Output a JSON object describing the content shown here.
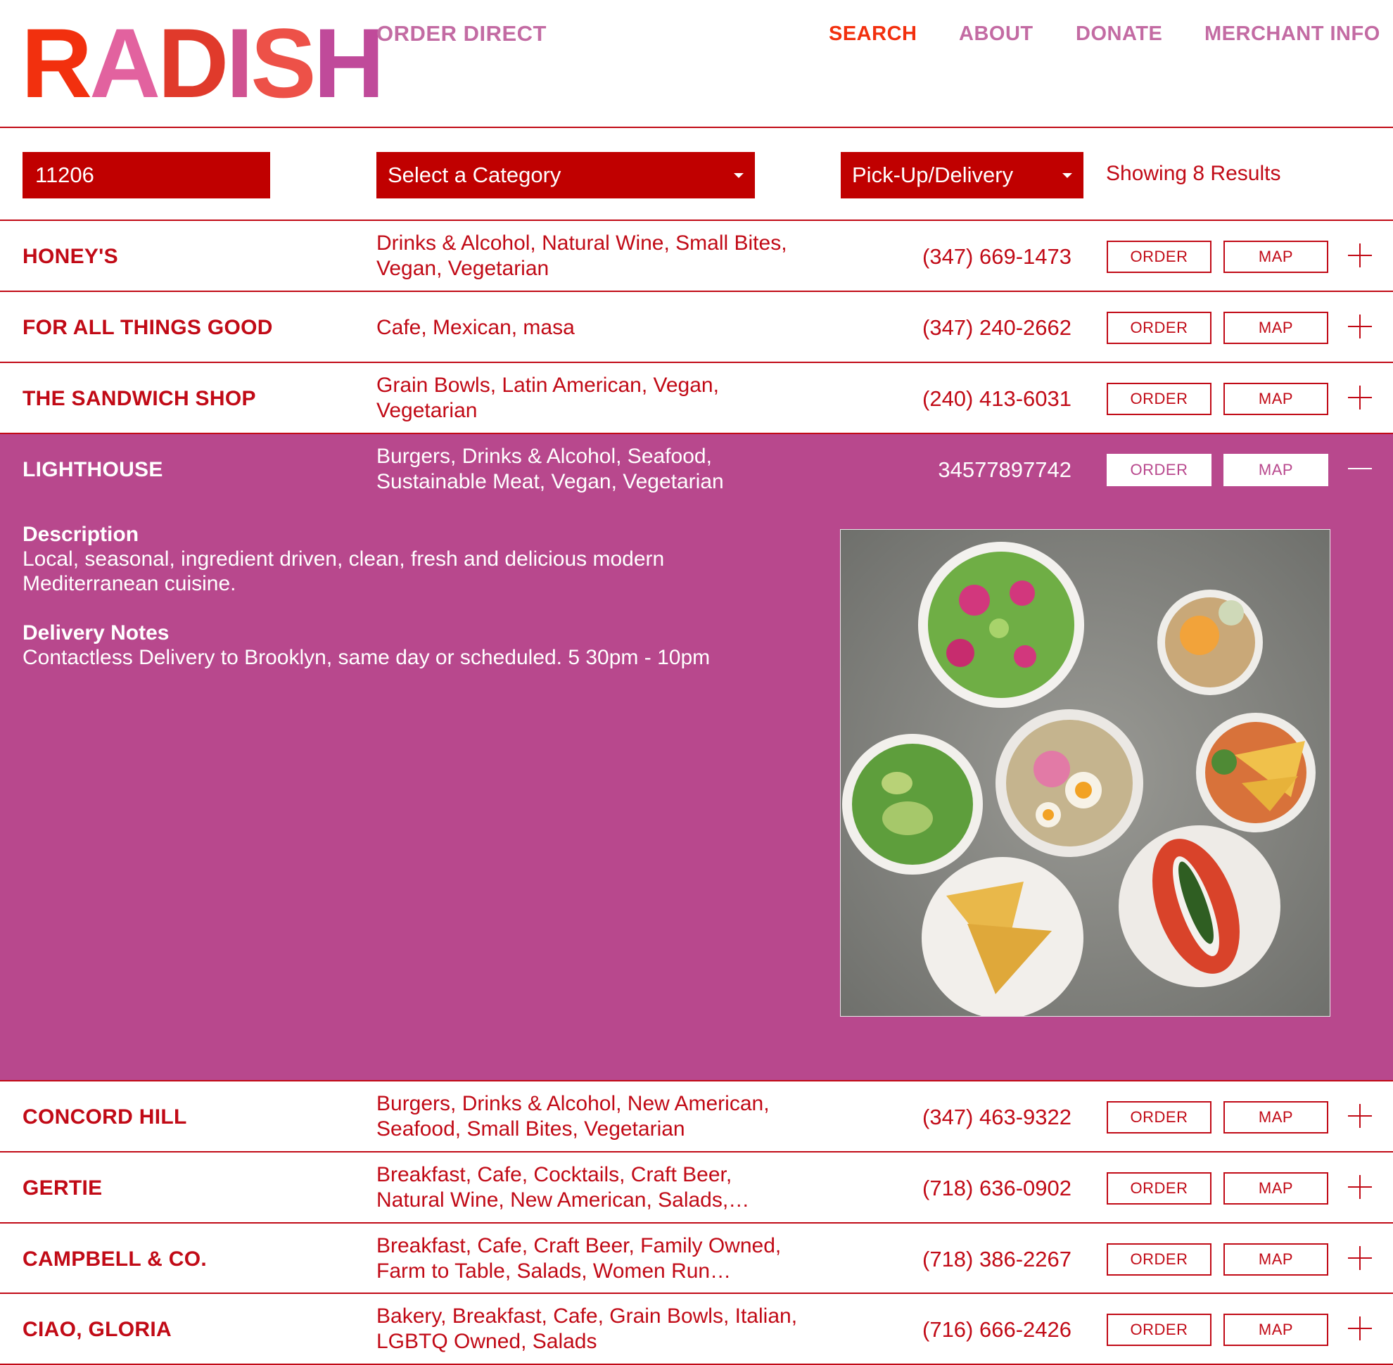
{
  "brand": {
    "logo_letters": [
      "R",
      "A",
      "D",
      "I",
      "S",
      "H"
    ],
    "logo_colors": [
      "#f2300e",
      "#e2629f",
      "#e03a2b",
      "#d05291",
      "#ed5148",
      "#c04a9a"
    ],
    "tagline": "ORDER DIRECT"
  },
  "nav": {
    "search": "SEARCH",
    "about": "ABOUT",
    "donate": "DONATE",
    "merchant_info": "MERCHANT INFO"
  },
  "filters": {
    "zip_value": "11206",
    "category_label": "Select a Category",
    "delivery_label": "Pick-Up/Delivery",
    "results_text": "Showing 8 Results"
  },
  "buttons": {
    "order": "ORDER",
    "map": "MAP"
  },
  "colors": {
    "primary": "#c10a16",
    "accent": "#b8488d",
    "nav": "#c36ba3",
    "active_nav": "#f2300e"
  },
  "restaurants": [
    {
      "name": "HONEY'S",
      "categories": "Drinks & Alcohol, Natural Wine, Small Bites, Vegan, Vegetarian",
      "phone": "(347) 669-1473"
    },
    {
      "name": "FOR ALL THINGS GOOD",
      "categories": "Cafe, Mexican, masa",
      "phone": "(347) 240-2662"
    },
    {
      "name": "THE SANDWICH SHOP",
      "categories": "Grain Bowls, Latin American, Vegan, Vegetarian",
      "phone": "(240) 413-6031"
    },
    {
      "name": "LIGHTHOUSE",
      "categories": "Burgers, Drinks & Alcohol, Seafood, Sustainable Meat, Vegan, Vegetarian",
      "phone": "34577897742",
      "description_label": "Description",
      "description": "Local, seasonal, ingredient driven, clean, fresh and delicious modern Mediterranean cuisine.",
      "delivery_notes_label": "Delivery Notes",
      "delivery_notes": "Contactless Delivery to Brooklyn, same day or scheduled. 5 30pm - 10pm"
    },
    {
      "name": "CONCORD HILL",
      "categories": "Burgers, Drinks & Alcohol, New American, Seafood, Small Bites, Vegetarian",
      "phone": "(347) 463-9322"
    },
    {
      "name": "GERTIE",
      "categories": "Breakfast, Cafe, Cocktails, Craft Beer, Natural Wine, New American, Salads,…",
      "phone": "(718) 636-0902"
    },
    {
      "name": "CAMPBELL & CO.",
      "categories": "Breakfast, Cafe, Craft Beer, Family Owned, Farm to Table, Salads, Women Run…",
      "phone": "(718) 386-2267"
    },
    {
      "name": "CIAO, GLORIA",
      "categories": "Bakery, Breakfast, Cafe, Grain Bowls, Italian, LGBTQ Owned, Salads",
      "phone": "(716) 666-2426"
    }
  ]
}
